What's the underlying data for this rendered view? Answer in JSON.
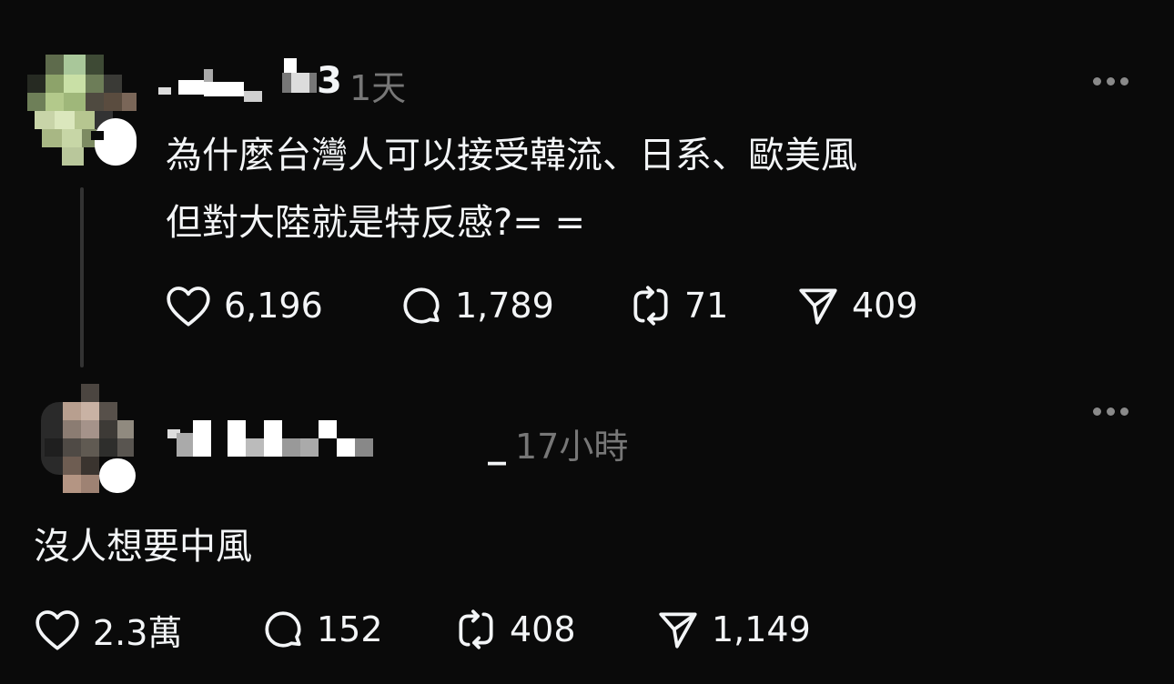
{
  "posts": [
    {
      "time": "1天",
      "username_fragment": "3",
      "text_lines": [
        "為什麼台灣人可以接受韓流、日系、歐美風",
        "但對大陸就是特反感?= ="
      ],
      "stats": {
        "likes": "6,196",
        "replies": "1,789",
        "reposts": "71",
        "shares": "409"
      }
    },
    {
      "time": "17小時",
      "username_fragment": "_",
      "text_lines": [
        "沒人想要中風"
      ],
      "stats": {
        "likes": "2.3萬",
        "replies": "152",
        "reposts": "408",
        "shares": "1,149"
      }
    }
  ],
  "icons": {
    "like": "heart-icon",
    "reply": "comment-icon",
    "repost": "repost-icon",
    "share": "send-icon",
    "more": "more-dots-icon"
  },
  "colors": {
    "background": "#0a0a0a",
    "text": "#f3f5f7",
    "muted": "#777777"
  }
}
